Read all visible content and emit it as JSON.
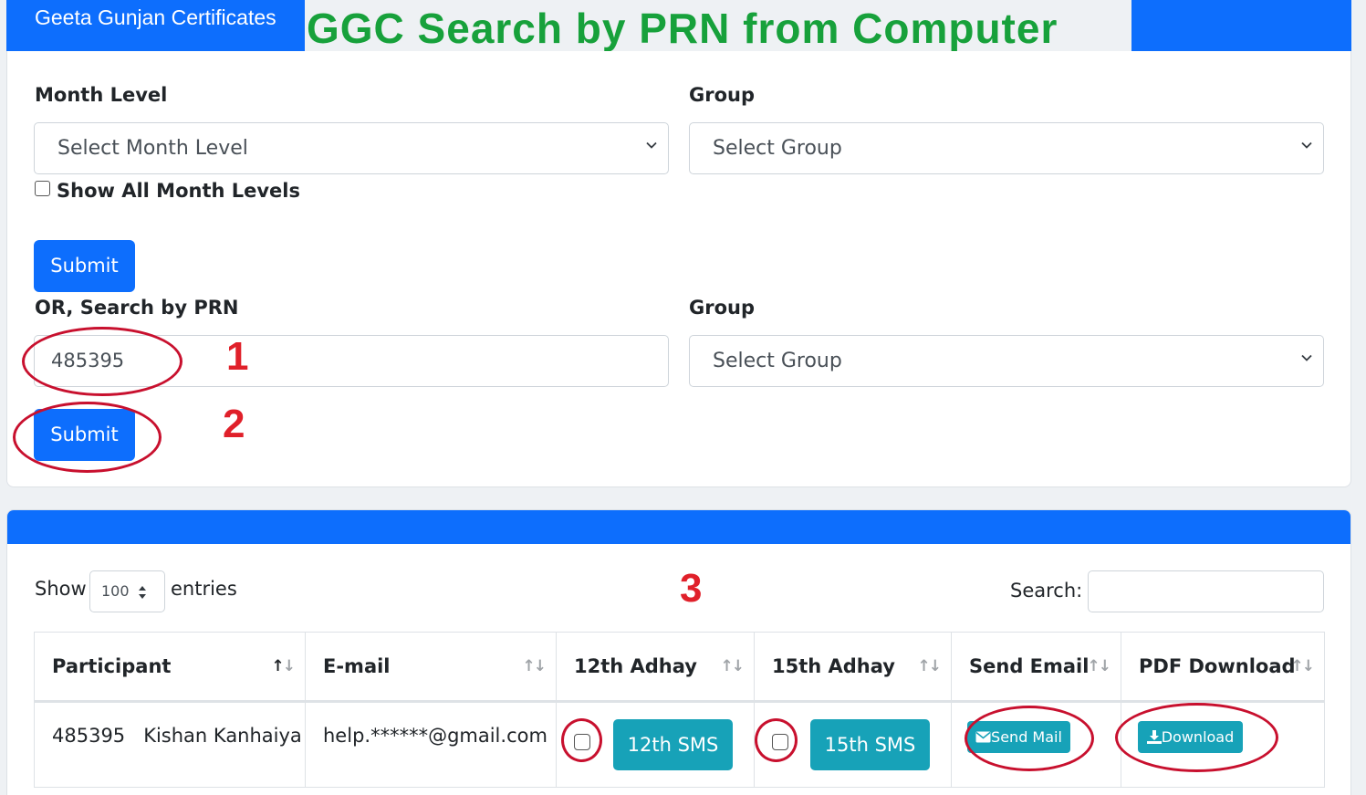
{
  "header": {
    "brand": "Geeta Gunjan Certificates",
    "overlay_title": "GGC Search by PRN from Computer"
  },
  "form": {
    "month_level_label": "Month Level",
    "month_level_select": "Select Month Level",
    "group_label": "Group",
    "group_select": "Select Group",
    "show_all_label": "Show All Month Levels",
    "submit_label": "Submit",
    "prn_label": "OR, Search by PRN",
    "prn_value": "485395",
    "group2_label": "Group",
    "group2_select": "Select Group",
    "submit2_label": "Submit"
  },
  "annotations": {
    "n1": "1",
    "n2": "2",
    "n3": "3"
  },
  "table_controls": {
    "show_label": "Show",
    "entries_value": "100",
    "entries_label": "entries",
    "search_label": "Search:"
  },
  "table": {
    "columns": [
      "Participant",
      "E-mail",
      "12th Adhay",
      "15th Adhay",
      "Send Email",
      "PDF Download"
    ],
    "rows": [
      {
        "prn": "485395",
        "name": "Kishan Kanhaiya",
        "email": "help.******@gmail.com",
        "sms12": "12th SMS",
        "sms15": "15th SMS",
        "send_mail": "Send Mail",
        "download": "Download"
      }
    ]
  },
  "colors": {
    "primary": "#0d6efd",
    "info": "#17a2b8",
    "annotation": "#e0202a",
    "title_green": "#17a13b"
  }
}
